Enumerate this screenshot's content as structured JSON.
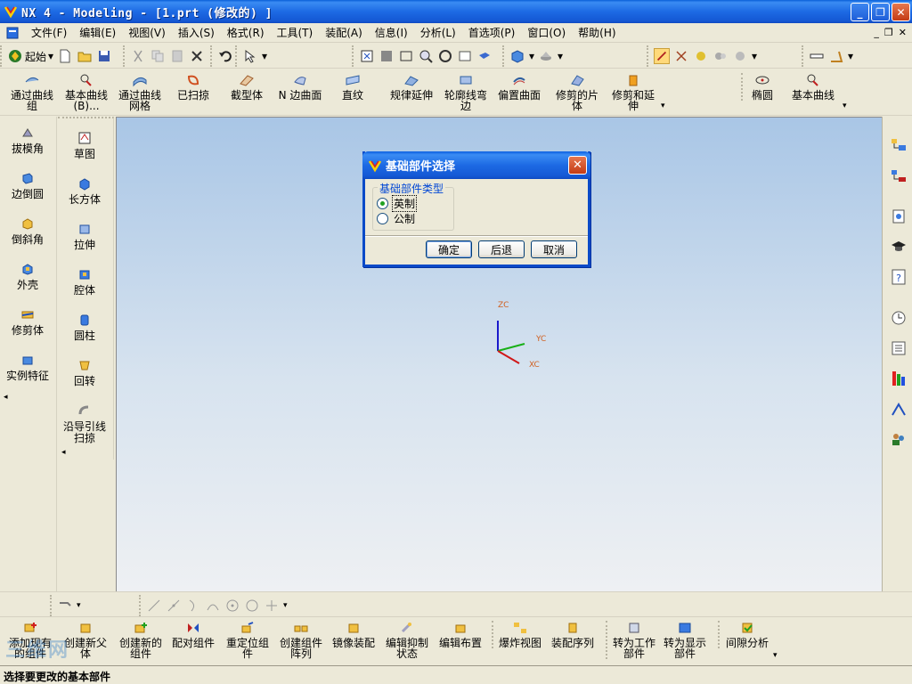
{
  "window": {
    "title": "NX 4 - Modeling - [1.prt  (修改的) ]",
    "controls": [
      "_",
      "❐",
      "✕"
    ]
  },
  "menu": {
    "items": [
      "文件(F)",
      "编辑(E)",
      "视图(V)",
      "插入(S)",
      "格式(R)",
      "工具(T)",
      "装配(A)",
      "信息(I)",
      "分析(L)",
      "首选项(P)",
      "窗口(O)",
      "帮助(H)"
    ],
    "mdi_controls": [
      "_",
      "❐",
      "✕"
    ]
  },
  "toolbar1": {
    "start_label": "起始"
  },
  "toolbar2": {
    "buttons": [
      "通过曲线\n组",
      "基本曲线\n(B)...",
      "通过曲线\n网格",
      "已扫掠",
      "截型体",
      "N 边曲面",
      "直纹",
      "规律延伸",
      "轮廓线弯\n边",
      "偏置曲面",
      "修剪的片\n体",
      "修剪和延\n伸",
      "椭圆",
      "基本曲线"
    ]
  },
  "left_palette_1": {
    "items": [
      "拔模角",
      "边倒圆",
      "倒斜角",
      "外壳",
      "修剪体",
      "实例特征"
    ]
  },
  "left_palette_2": {
    "items": [
      "草图",
      "长方体",
      "拉伸",
      "腔体",
      "圆柱",
      "回转",
      "沿导引线\n扫掠"
    ]
  },
  "assembly_toolbar": {
    "buttons": [
      "添加现有\n的组件",
      "创建新父\n体",
      "创建新的\n组件",
      "配对组件",
      "重定位组\n件",
      "创建组件\n阵列",
      "镜像装配",
      "编辑抑制\n状态",
      "编辑布置",
      "爆炸视图",
      "装配序列",
      "转为工作\n部件",
      "转为显示\n部件",
      "间隙分析"
    ]
  },
  "dialog": {
    "title": "基础部件选择",
    "group_label": "基础部件类型",
    "options": [
      {
        "label": "英制",
        "checked": true
      },
      {
        "label": "公制",
        "checked": false
      }
    ],
    "ok_label": "确定",
    "back_label": "后退",
    "cancel_label": "取消"
  },
  "triad": {
    "zc": "ZC",
    "yc": "YC",
    "xc": "XC",
    "colors": {
      "z": "#1a1acc",
      "y": "#18b018",
      "x": "#d01818"
    }
  },
  "watermark": "三维网",
  "status_text": "选择要更改的基本部件"
}
